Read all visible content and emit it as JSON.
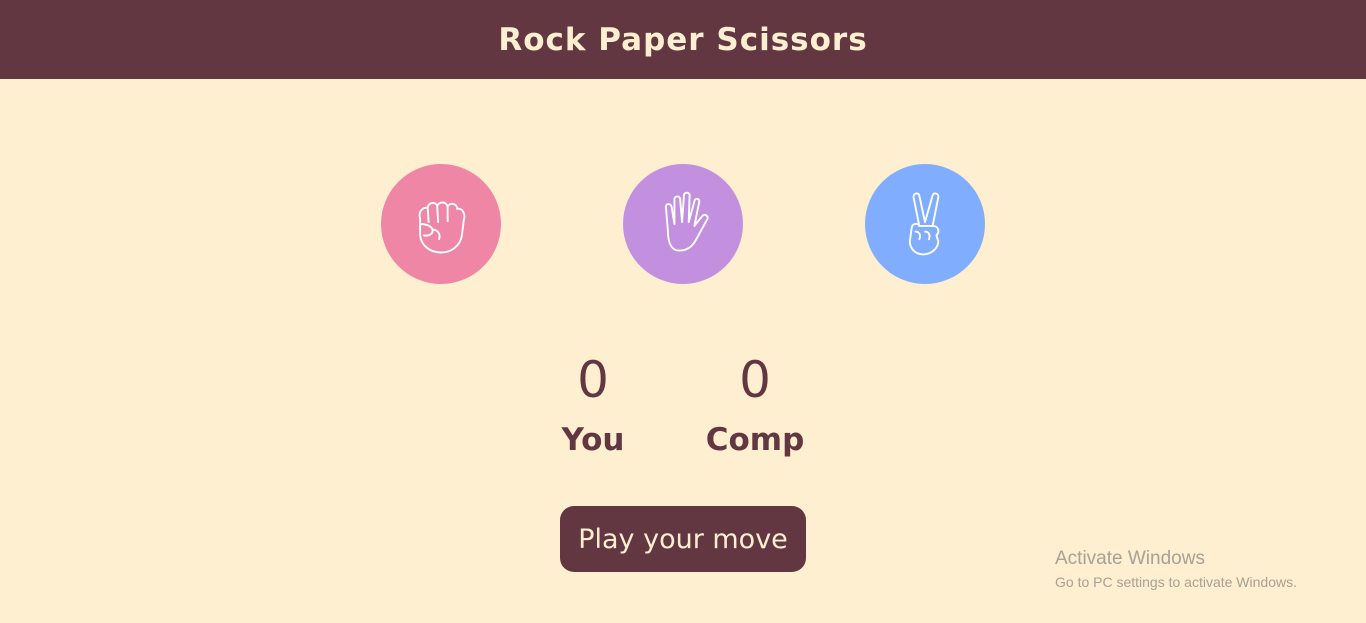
{
  "header": {
    "title": "Rock Paper Scissors"
  },
  "choices": [
    {
      "label": "rock",
      "icon": "fist-icon",
      "color": "#ef86a6"
    },
    {
      "label": "paper",
      "icon": "open-hand-icon",
      "color": "#c390e0"
    },
    {
      "label": "scissors",
      "icon": "peace-hand-icon",
      "color": "#80adfd"
    }
  ],
  "scores": {
    "user": {
      "value": "0",
      "label": "You"
    },
    "comp": {
      "value": "0",
      "label": "Comp"
    }
  },
  "play_button": {
    "label": "Play your move"
  },
  "watermark": {
    "line1": "Activate Windows",
    "line2": "Go to PC settings to activate Windows."
  },
  "colors": {
    "primary": "#633742",
    "background": "#fdefcf"
  }
}
